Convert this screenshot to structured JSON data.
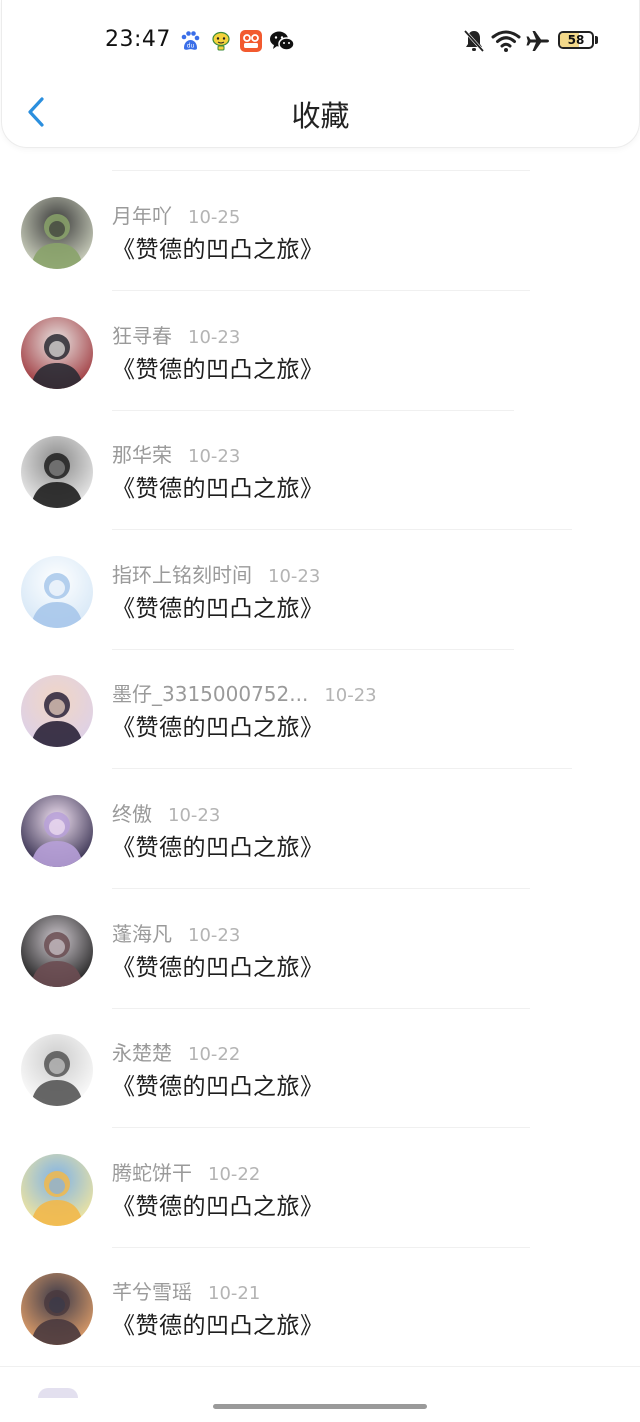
{
  "status_bar": {
    "time": "23:47",
    "battery_level": 58,
    "battery_text": "58",
    "notification_icons": [
      "baidu-icon",
      "yellow-character-icon",
      "shopping-app-icon",
      "wechat-icon"
    ],
    "system_icons": [
      "mute-bell-icon",
      "wifi-icon",
      "airplane-icon",
      "battery-icon"
    ]
  },
  "header": {
    "title": "收藏",
    "back_icon": "chevron-left-icon",
    "accent_color": "#2b8fde"
  },
  "list": {
    "items": [
      {
        "author": "月年吖",
        "date": "10-25",
        "title": "《赞德的凹凸之旅》",
        "avatar": [
          "#d7dcc8",
          "#8aa36a",
          "#3a3a3a"
        ]
      },
      {
        "author": "狂寻春",
        "date": "10-23",
        "title": "《赞德的凹凸之旅》",
        "avatar": [
          "#9b2f35",
          "#2a2a33",
          "#e9e5e3"
        ]
      },
      {
        "author": "那华荣",
        "date": "10-23",
        "title": "《赞德的凹凸之旅》",
        "avatar": [
          "#f0f0f0",
          "#1e1e1e",
          "#8a8a8a"
        ]
      },
      {
        "author": "指环上铭刻时间",
        "date": "10-23",
        "title": "《赞德的凹凸之旅》",
        "avatar": [
          "#d4e6f6",
          "#a7c7ea",
          "#ffffff"
        ]
      },
      {
        "author": "墨仔_3315000752...",
        "date": "10-23",
        "title": "《赞德的凹凸之旅》",
        "avatar": [
          "#dcd0ea",
          "#2a2238",
          "#f1d6c4"
        ]
      },
      {
        "author": "终傲",
        "date": "10-23",
        "title": "《赞德的凹凸之旅》",
        "avatar": [
          "#2b2546",
          "#b7a0d8",
          "#f2e2f2"
        ]
      },
      {
        "author": "蓬海凡",
        "date": "10-23",
        "title": "《赞德的凹凸之旅》",
        "avatar": [
          "#181818",
          "#6b4d52",
          "#cfc9cf"
        ]
      },
      {
        "author": "永楚楚",
        "date": "10-22",
        "title": "《赞德的凹凸之旅》",
        "avatar": [
          "#ffffff",
          "#555555",
          "#cccccc"
        ]
      },
      {
        "author": "腾蛇饼干",
        "date": "10-22",
        "title": "《赞德的凹凸之旅》",
        "avatar": [
          "#f7e89a",
          "#f2b84a",
          "#7fb2e8"
        ]
      },
      {
        "author": "芊兮雪瑶",
        "date": "10-21",
        "title": "《赞德的凹凸之旅》",
        "avatar": [
          "#e8a36a",
          "#4a3a3e",
          "#3b3a4a"
        ]
      }
    ]
  }
}
